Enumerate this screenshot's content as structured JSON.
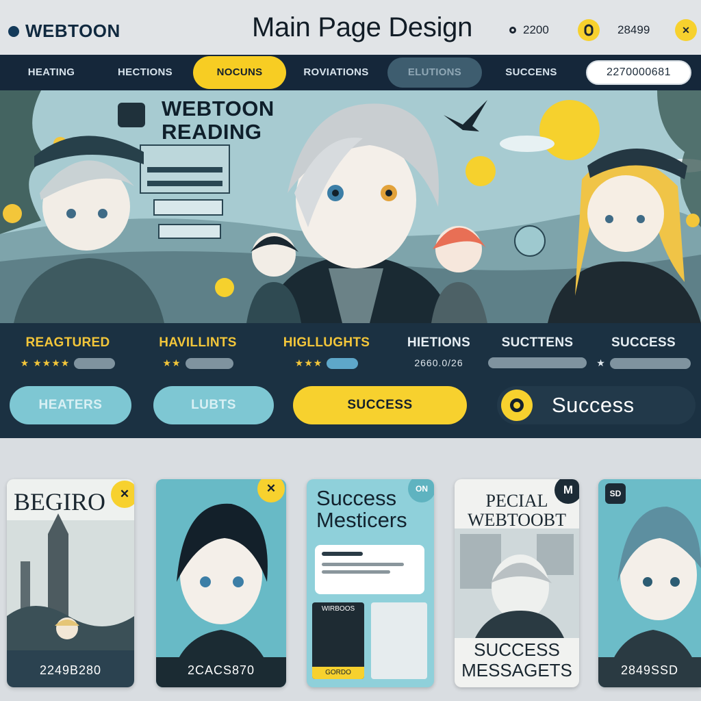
{
  "header": {
    "logo": "WEBTOON",
    "title": "Main Page Design",
    "stat_left": "2200",
    "stat_right": "28499",
    "coin_icon": "coin-icon",
    "close_label": "✕"
  },
  "nav": {
    "items": [
      {
        "label": "HEATING"
      },
      {
        "label": "HECTIONS"
      },
      {
        "label": "NOCUNS"
      },
      {
        "label": "ROVIATIONS"
      },
      {
        "label": "ELUTIONS"
      },
      {
        "label": "SUCCENS"
      }
    ],
    "search_value": "2270000681"
  },
  "hero": {
    "title_line1": "WEBTOON",
    "title_line2": "READING"
  },
  "highlights": [
    {
      "title": "REAGTURED",
      "stars": "★ ★★★★"
    },
    {
      "title": "HAVILLINTS",
      "stars": "★★"
    },
    {
      "title": "HIGLLUGHTS",
      "stars": "★★★"
    },
    {
      "title": "HIETIONS",
      "stars": "2660.0/26"
    },
    {
      "title": "SUCTTENS",
      "stars": ""
    },
    {
      "title": "SUCCESS",
      "stars": "★"
    }
  ],
  "pills": {
    "pill1": "HEATERS",
    "pill2": "LUBTS",
    "pill3": "SUCCESS",
    "pill4": "Success"
  },
  "cards": [
    {
      "title": "BEGIRO",
      "code": "2249B280",
      "badge": "✕"
    },
    {
      "title": "",
      "code": "2CACS870",
      "badge": "✕"
    },
    {
      "title": "Success Mesticers",
      "code": "",
      "badge": "ON",
      "tag": "WIRBOOS",
      "tag2": "GORDO"
    },
    {
      "title": "PECIAL WEBTOOBT",
      "code": "",
      "badge": "M",
      "footer1": "SUCCESS",
      "footer2": "MESSAGETS"
    },
    {
      "title": "",
      "code": "2849SSD",
      "badge": "SD"
    }
  ],
  "colors": {
    "accent": "#f7d12e",
    "navy": "#15273a",
    "teal": "#7ec7d3"
  }
}
